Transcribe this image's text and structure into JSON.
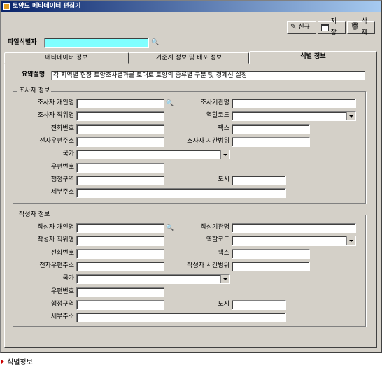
{
  "window": {
    "title": "토양도 메타데이터 편집기"
  },
  "toolbar": {
    "new_label": "신규",
    "save_label": "저장",
    "delete_label": "삭제"
  },
  "file_id": {
    "label": "파일식별자",
    "value": ""
  },
  "tabs": [
    "메타데이터 정보",
    "기준계 정보 및 배포 정보",
    "식별 정보"
  ],
  "summary": {
    "label": "요약설명",
    "value": "각 지역별 현장 토양조사결과를 토대로 토양의 종류별 구분 및 경계선 설정"
  },
  "investigator": {
    "group_title": "조사자 정보",
    "personal_name": "조사자 개인명",
    "org_name": "조사기관명",
    "position": "조사자 직위명",
    "role_code": "역할코드",
    "phone": "전화번호",
    "fax": "팩스",
    "email": "전자우편주소",
    "hours": "조사자 시간범위",
    "country": "국가",
    "postal": "우편번호",
    "admin_area": "행정구역",
    "city": "도시",
    "address": "세부주소"
  },
  "author": {
    "group_title": "작성자 정보",
    "personal_name": "작성자 개인명",
    "org_name": "작성기관명",
    "position": "작성자 직위명",
    "role_code": "역할코드",
    "phone": "전화번호",
    "fax": "팩스",
    "email": "전자우편주소",
    "hours": "작성자 시간범위",
    "country": "국가",
    "postal": "우편번호",
    "admin_area": "행정구역",
    "city": "도시",
    "address": "세부주소"
  },
  "status_bar": {
    "text": "식별정보"
  }
}
